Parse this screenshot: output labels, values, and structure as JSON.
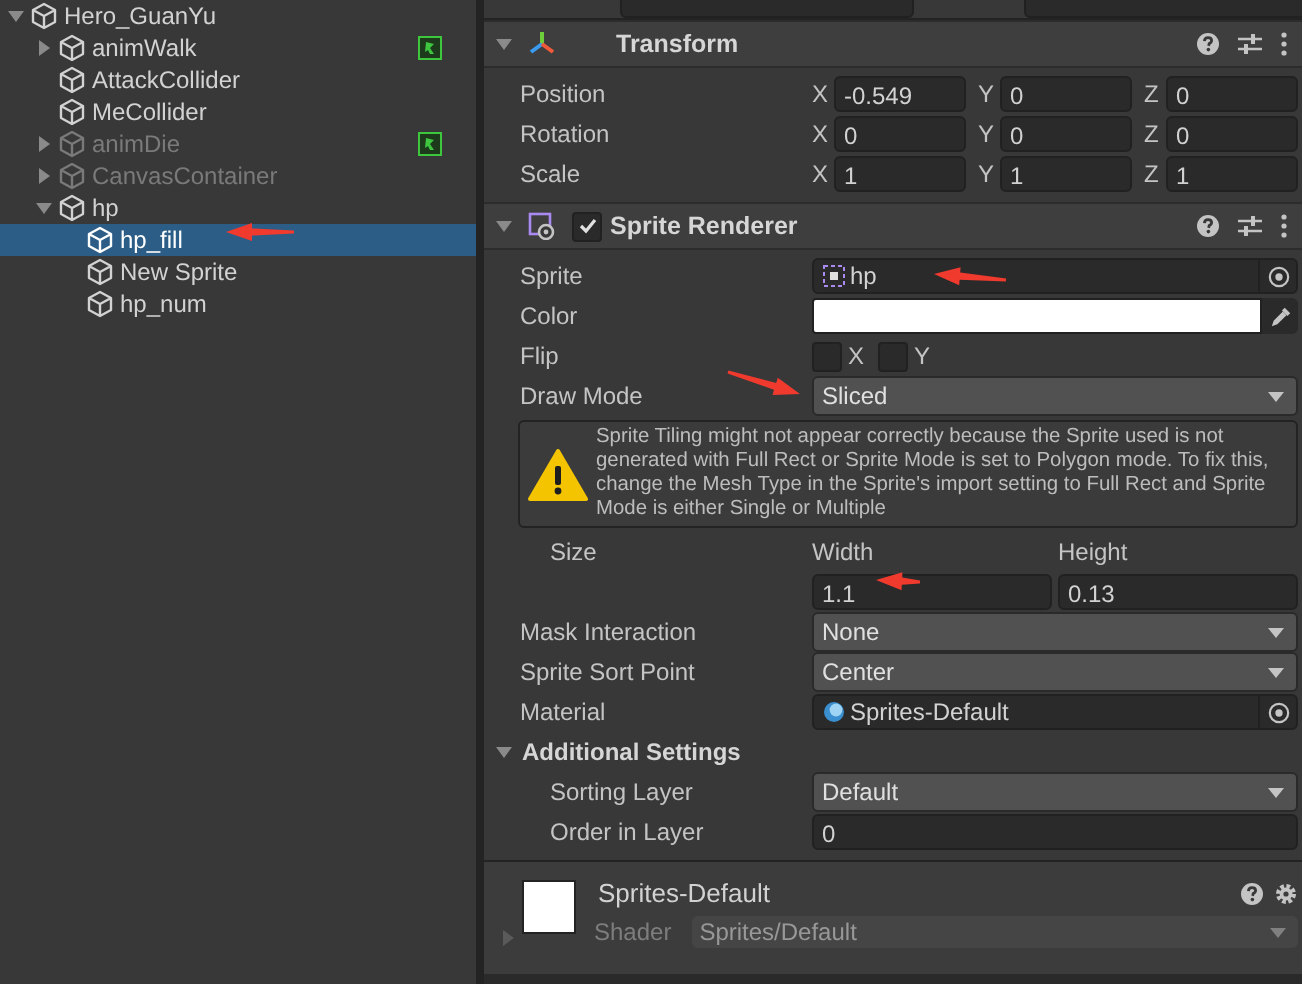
{
  "hierarchy": {
    "items": [
      {
        "name": "Hero_GuanYu",
        "expanded": true,
        "selected": false,
        "disabled": false,
        "children": [
          {
            "name": "animWalk",
            "expanded": false,
            "selected": false,
            "disabled": false,
            "animator": true
          },
          {
            "name": "AttackCollider",
            "selected": false,
            "disabled": false
          },
          {
            "name": "MeCollider",
            "selected": false,
            "disabled": false
          },
          {
            "name": "animDie",
            "expanded": false,
            "selected": false,
            "disabled": true,
            "animator": true
          },
          {
            "name": "CanvasContainer",
            "expanded": false,
            "selected": false,
            "disabled": true
          },
          {
            "name": "hp",
            "expanded": true,
            "selected": false,
            "disabled": false,
            "children": [
              {
                "name": "hp_fill",
                "selected": true,
                "disabled": false
              },
              {
                "name": "New Sprite",
                "selected": false,
                "disabled": false
              },
              {
                "name": "hp_num",
                "selected": false,
                "disabled": false
              }
            ]
          }
        ]
      }
    ]
  },
  "inspector": {
    "components": [
      {
        "kind": "transform",
        "title": "Transform",
        "expanded": true,
        "properties": [
          {
            "kind": "vector3",
            "label": "Position",
            "fields": [
              {
                "axis": "X",
                "value": "-0.549"
              },
              {
                "axis": "Y",
                "value": "0"
              },
              {
                "axis": "Z",
                "value": "0"
              }
            ]
          },
          {
            "kind": "vector3",
            "label": "Rotation",
            "fields": [
              {
                "axis": "X",
                "value": "0"
              },
              {
                "axis": "Y",
                "value": "0"
              },
              {
                "axis": "Z",
                "value": "0"
              }
            ]
          },
          {
            "kind": "vector3",
            "label": "Scale",
            "fields": [
              {
                "axis": "X",
                "value": "1"
              },
              {
                "axis": "Y",
                "value": "1"
              },
              {
                "axis": "Z",
                "value": "1"
              }
            ]
          }
        ]
      },
      {
        "kind": "sprite_renderer",
        "title": "Sprite Renderer",
        "expanded": true,
        "enabled": true,
        "properties": [
          {
            "kind": "sprite_object",
            "label": "Sprite",
            "value": "hp"
          },
          {
            "kind": "color",
            "label": "Color",
            "color": "#ffffff"
          },
          {
            "kind": "flip",
            "label": "Flip",
            "toggles": [
              {
                "label": "X",
                "checked": false
              },
              {
                "label": "Y",
                "checked": false
              }
            ]
          },
          {
            "kind": "dropdown",
            "label": "Draw Mode",
            "value": "Sliced"
          },
          {
            "kind": "helpbox",
            "text": "Sprite Tiling might not appear correctly because the Sprite used is not generated with Full Rect or Sprite Mode is set to Polygon mode. To fix this, change the Mesh Type in the Sprite's import setting to Full Rect and Sprite Mode is either Single or Multiple"
          },
          {
            "kind": "size",
            "label": "Size",
            "fields": [
              {
                "label": "Width",
                "value": "1.1"
              },
              {
                "label": "Height",
                "value": "0.13"
              }
            ]
          },
          {
            "kind": "dropdown",
            "label": "Mask Interaction",
            "value": "None"
          },
          {
            "kind": "dropdown",
            "label": "Sprite Sort Point",
            "value": "Center"
          },
          {
            "kind": "material_object",
            "label": "Material",
            "value": "Sprites-Default"
          },
          {
            "kind": "section",
            "label": "Additional Settings",
            "expanded": true,
            "children": [
              {
                "kind": "dropdown",
                "label": "Sorting Layer",
                "value": "Default"
              },
              {
                "kind": "number",
                "label": "Order in Layer",
                "value": "0"
              }
            ]
          }
        ]
      }
    ],
    "material": {
      "name": "Sprites-Default",
      "shader_label": "Shader",
      "shader": "Sprites/Default"
    }
  }
}
